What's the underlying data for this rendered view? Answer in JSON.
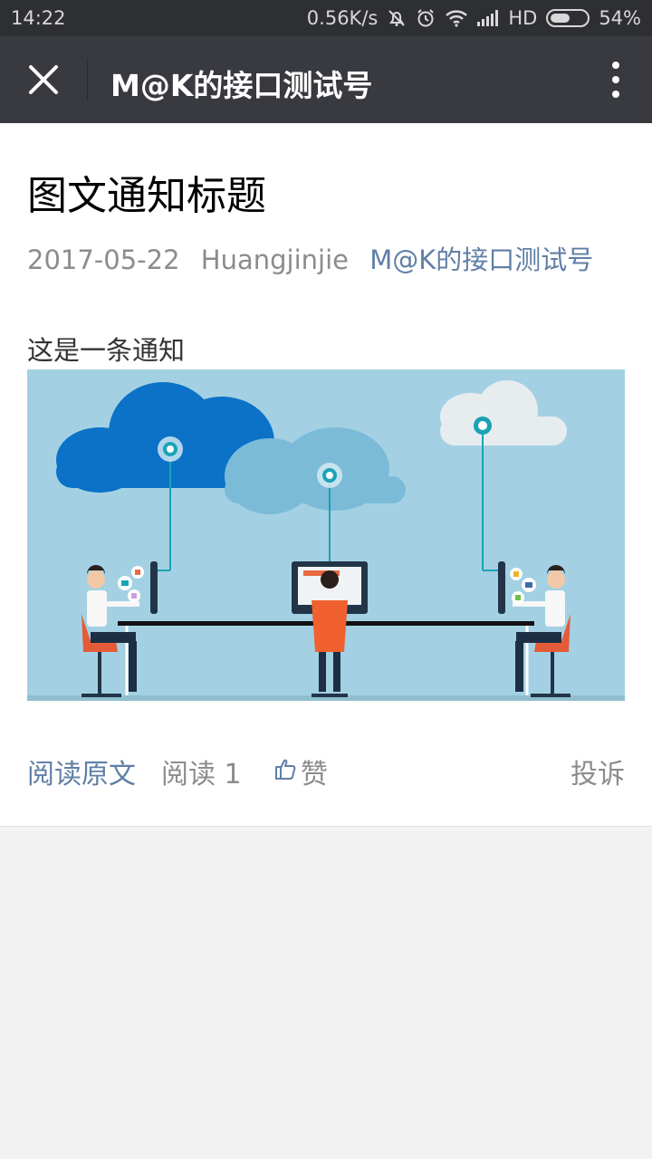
{
  "status_bar": {
    "time": "14:22",
    "speed": "0.56K/s",
    "network": "HD",
    "battery_percent": "54%",
    "battery_level": 0.54,
    "icons": [
      "mute-icon",
      "alarm-icon",
      "wifi-icon",
      "signal-icon",
      "battery-icon"
    ]
  },
  "nav": {
    "title": "M@K的接口测试号",
    "close_icon": "close-icon",
    "more_icon": "more-icon"
  },
  "article": {
    "title": "图文通知标题",
    "date": "2017-05-22",
    "author": "Huangjinjie",
    "account": "M@K的接口测试号",
    "body": "这是一条通知",
    "image": "cloud-network-illustration"
  },
  "footer": {
    "read_original": "阅读原文",
    "read_count": "阅读 1",
    "like": "赞",
    "report": "投诉"
  },
  "colors": {
    "status_bar": "#2e2f33",
    "nav_bar": "#393a3f",
    "link": "#607fa6",
    "meta": "#8c8c8c",
    "page_bg": "#f2f2f2",
    "illustration_bg": "#a3d1e3"
  }
}
